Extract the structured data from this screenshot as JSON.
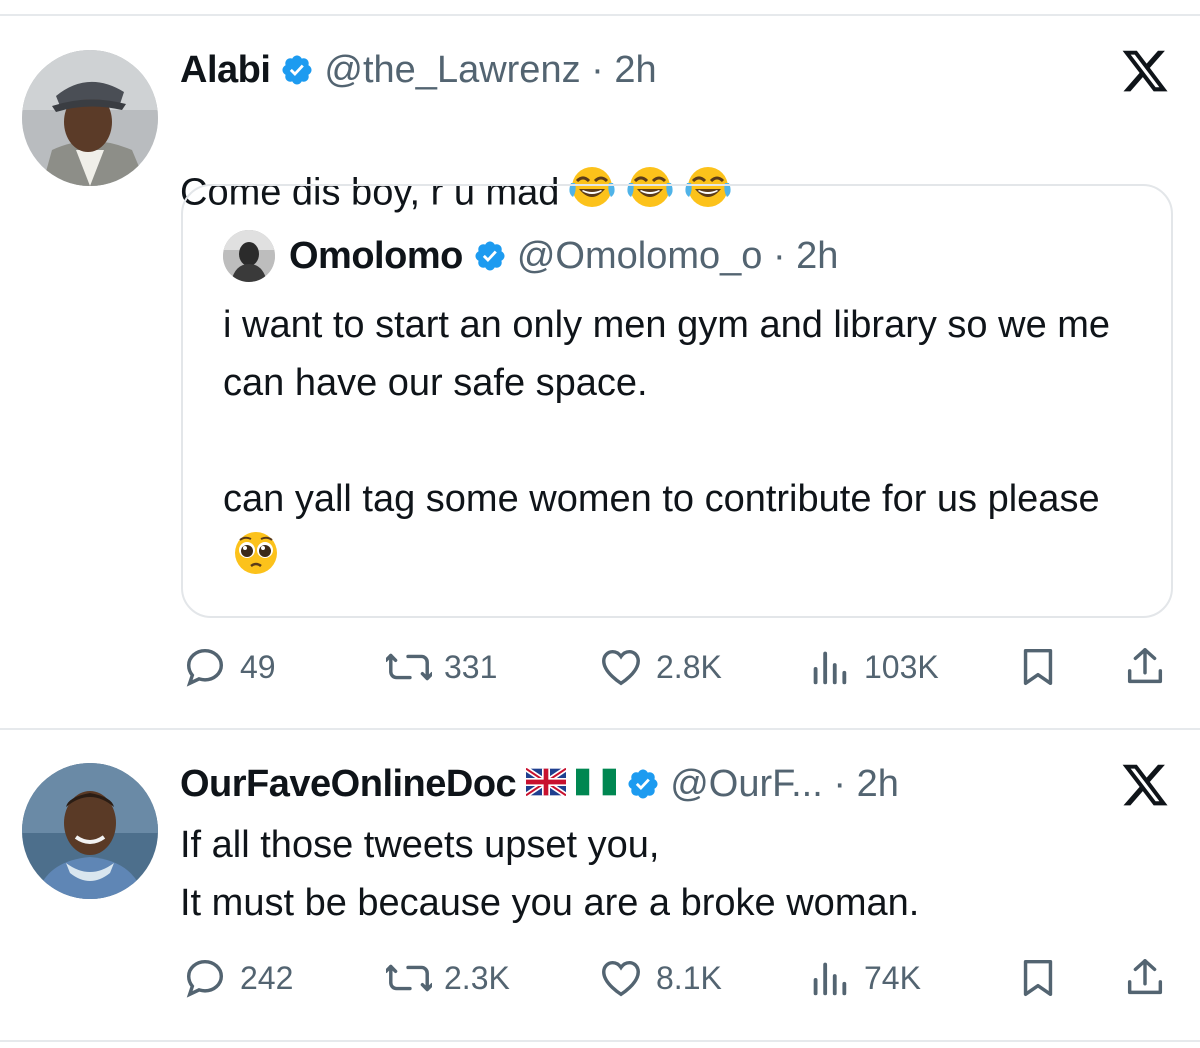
{
  "tweets": [
    {
      "name": "Alabi",
      "handle": "@the_Lawrenz · 2h",
      "text": "Come dis boy, r u mad",
      "emojis": [
        "face-with-tears-of-joy",
        "face-with-tears-of-joy",
        "face-with-tears-of-joy"
      ],
      "quote": {
        "name": "Omolomo",
        "handle": "@Omolomo_o · 2h",
        "paragraph1": "i want to start an only men gym and library so we me can have our safe space.",
        "paragraph2": "can yall tag some women to contribute for us please",
        "emoji": "pleading-face"
      },
      "stats": {
        "replies": "49",
        "retweets": "331",
        "likes": "2.8K",
        "views": "103K"
      }
    },
    {
      "name": "OurFaveOnlineDoc",
      "flags": [
        "uk-flag",
        "nigeria-flag"
      ],
      "handle": "@OurF... · 2h",
      "text": "If all those tweets upset you,\nIt must be because you are a broke woman.",
      "stats": {
        "replies": "242",
        "retweets": "2.3K",
        "likes": "8.1K",
        "views": "74K"
      }
    }
  ],
  "icons": {
    "reply": "reply-icon",
    "retweet": "retweet-icon",
    "like": "heart-icon",
    "views": "views-icon",
    "bookmark": "bookmark-icon",
    "share": "share-icon",
    "brand": "x-logo-icon",
    "verified": "verified-badge-icon"
  },
  "colors": {
    "verified": "#1d9bf0",
    "muted": "#536471",
    "text": "#0f1419",
    "divider": "#e6e9ec"
  }
}
